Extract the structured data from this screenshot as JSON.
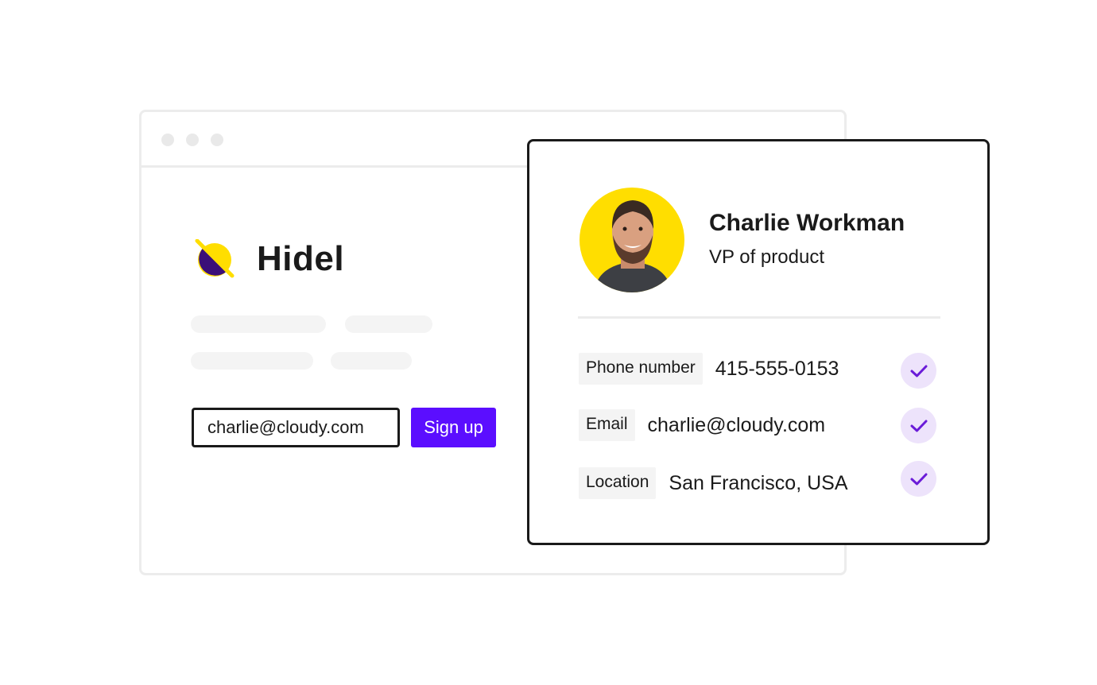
{
  "signup_page": {
    "brand": "Hidel",
    "email_value": "charlie@cloudy.com",
    "signup_label": "Sign up"
  },
  "profile": {
    "name": "Charlie Workman",
    "role": "VP of product",
    "fields": [
      {
        "label": "Phone number",
        "value": "415-555-0153",
        "verified": true
      },
      {
        "label": "Email",
        "value": "charlie@cloudy.com",
        "verified": true
      },
      {
        "label": "Location",
        "value": "San Francisco, USA",
        "verified": true
      }
    ]
  },
  "colors": {
    "accent": "#5b0eff",
    "brand_yellow": "#ffde00",
    "brand_purple": "#3b0f78",
    "check_bg": "#ede3fb"
  },
  "icons": {
    "logo": "hidel-logo-icon",
    "verified": "checkmark-icon"
  }
}
